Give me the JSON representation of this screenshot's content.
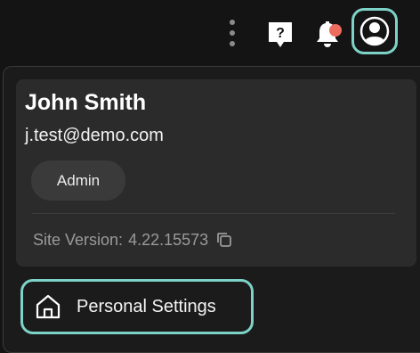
{
  "header": {
    "more_icon": "kebab-vertical-icon",
    "help_icon": "help-chat-icon",
    "help_glyph": "?",
    "notification_icon": "bell-icon",
    "account_icon": "user-circle-icon"
  },
  "profile": {
    "name": "John Smith",
    "email": "j.test@demo.com",
    "role": "Admin",
    "version_label": "Site Version:",
    "version": "4.22.15573",
    "copy_icon": "copy-icon"
  },
  "menu": {
    "personal_settings": {
      "label": "Personal Settings",
      "icon": "home-icon"
    }
  },
  "colors": {
    "background": "#141414",
    "panel": "#1b1b1b",
    "card": "#2b2b2b",
    "accent": "#7dd3c8",
    "notification_dot": "#ee6b5f"
  }
}
